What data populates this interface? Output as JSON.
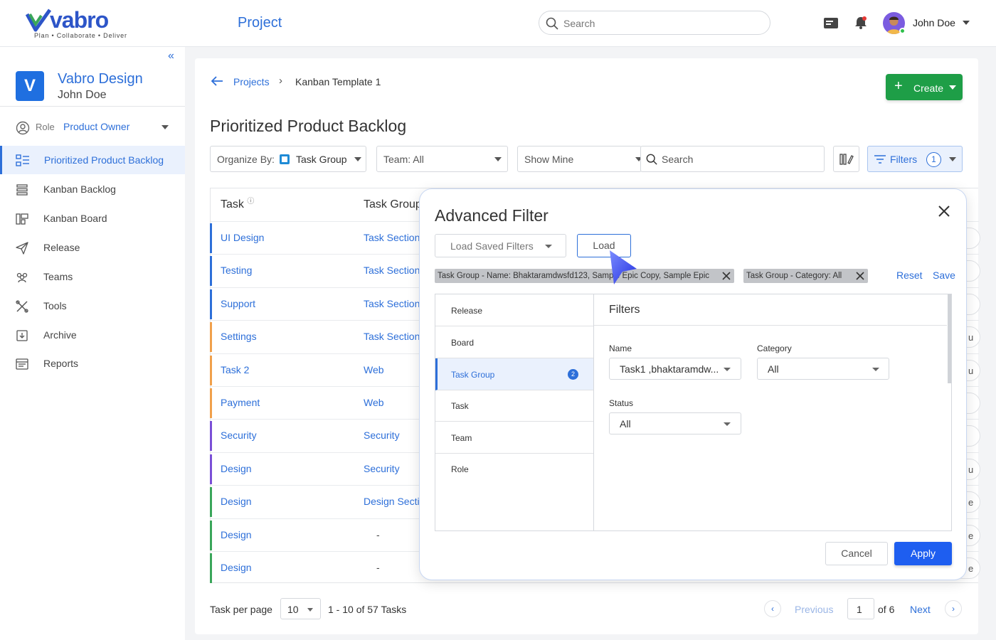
{
  "app": {
    "logo_word": "vabro",
    "logo_tagline": "Plan • Collaborate • Deliver",
    "section_title": "Project",
    "search_placeholder": "Search",
    "user_name": "John Doe",
    "colors": {
      "brand": "#2d6fd9",
      "create_green": "#1e9e47",
      "apply_blue": "#1e5ef0"
    }
  },
  "sidebar": {
    "project_initial": "V",
    "project_name": "Vabro Design",
    "project_user": "John Doe",
    "role_label": "Role",
    "role_value": "Product Owner",
    "items": [
      {
        "label": "Prioritized Product Backlog",
        "icon": "backlog-icon",
        "active": true
      },
      {
        "label": "Kanban Backlog",
        "icon": "list-icon"
      },
      {
        "label": "Kanban Board",
        "icon": "board-icon"
      },
      {
        "label": "Release",
        "icon": "send-icon"
      },
      {
        "label": "Teams",
        "icon": "team-icon"
      },
      {
        "label": "Tools",
        "icon": "tools-icon"
      },
      {
        "label": "Archive",
        "icon": "archive-icon"
      },
      {
        "label": "Reports",
        "icon": "report-icon"
      }
    ]
  },
  "main": {
    "breadcrumb": {
      "root": "Projects",
      "current": "Kanban Template 1"
    },
    "create_label": "Create",
    "page_title": "Prioritized Product Backlog",
    "controls": {
      "organize_label": "Organize By:",
      "organize_value": "Task Group",
      "team": "Team: All",
      "show_mine": "Show Mine",
      "search_placeholder": "Search",
      "filters_label": "Filters",
      "filters_count": "1"
    },
    "table": {
      "col_task": "Task",
      "col_group": "Task Group",
      "rows": [
        {
          "task": "UI Design",
          "group": "Task Section",
          "color": "#2d6fd9",
          "pill": ""
        },
        {
          "task": "Testing",
          "group": "Task Section",
          "color": "#2d6fd9",
          "pill": ""
        },
        {
          "task": "Support",
          "group": "Task Section",
          "color": "#2d6fd9",
          "pill": ""
        },
        {
          "task": "Settings",
          "group": "Task Section",
          "color": "#f0a04b",
          "pill": "u"
        },
        {
          "task": "Task 2",
          "group": "Web",
          "color": "#f0a04b",
          "pill": "u"
        },
        {
          "task": "Payment",
          "group": "Web",
          "color": "#f0a04b",
          "pill": ""
        },
        {
          "task": "Security",
          "group": "Security",
          "color": "#7a4fd6",
          "pill": ""
        },
        {
          "task": "Design",
          "group": "Security",
          "color": "#7a4fd6",
          "pill": "u"
        },
        {
          "task": "Design",
          "group": "Design Section",
          "color": "#3aa65a",
          "pill": "e"
        },
        {
          "task": "Design",
          "group": "-",
          "color": "#3aa65a",
          "pill": "e"
        },
        {
          "task": "Design",
          "group": "-",
          "color": "#3aa65a",
          "pill": "e"
        }
      ]
    },
    "pager": {
      "per_page_label": "Task per page",
      "per_page": "10",
      "range": "1 - 10 of 57 Tasks",
      "prev": "Previous",
      "page": "1",
      "of": "of 6",
      "next": "Next"
    }
  },
  "modal": {
    "title": "Advanced Filter",
    "saved_placeholder": "Load Saved Filters",
    "load_label": "Load",
    "chips": [
      "Task Group - Name: Bhaktaramdwsfd123, Sample Epic Copy, Sample Epic",
      "Task Group  -  Category: All"
    ],
    "reset": "Reset",
    "save": "Save",
    "categories": [
      {
        "label": "Release"
      },
      {
        "label": "Board"
      },
      {
        "label": "Task Group",
        "count": "2",
        "active": true
      },
      {
        "label": "Task"
      },
      {
        "label": "Team"
      },
      {
        "label": "Role"
      }
    ],
    "panel_title": "Filters",
    "fields": {
      "name_label": "Name",
      "name_value": "Task1 ,bhaktaramdw...",
      "category_label": "Category",
      "category_value": "All",
      "status_label": "Status",
      "status_value": "All"
    },
    "cancel": "Cancel",
    "apply": "Apply"
  }
}
